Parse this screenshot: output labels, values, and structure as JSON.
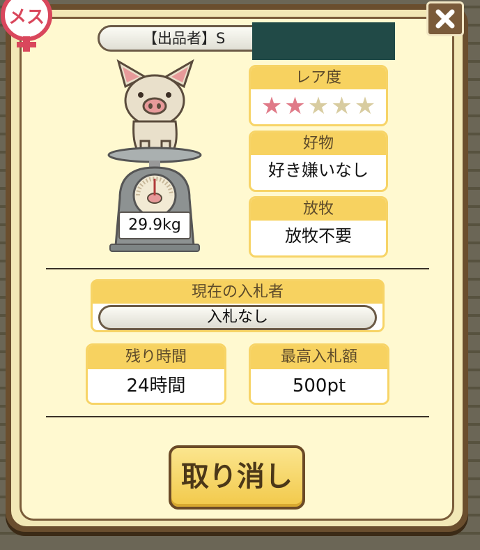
{
  "badge": {
    "text": "メス",
    "color": "#d9475c"
  },
  "close": {
    "label": "×"
  },
  "seller": {
    "label": "【出品者】S"
  },
  "pig": {
    "weight": "29.9kg"
  },
  "rarity": {
    "title": "レア度",
    "stars_total": 5,
    "stars_filled": 2,
    "filled_color": "#e07a88",
    "empty_color": "#d8cca0"
  },
  "favorite": {
    "title": "好物",
    "value": "好き嫌いなし"
  },
  "grazing": {
    "title": "放牧",
    "value": "放牧不要"
  },
  "bidder": {
    "title": "現在の入札者",
    "value": "入札なし"
  },
  "time_left": {
    "title": "残り時間",
    "value": "24時間"
  },
  "top_bid": {
    "title": "最高入札額",
    "value": "500pt"
  },
  "cancel": {
    "label": "取り消し"
  }
}
